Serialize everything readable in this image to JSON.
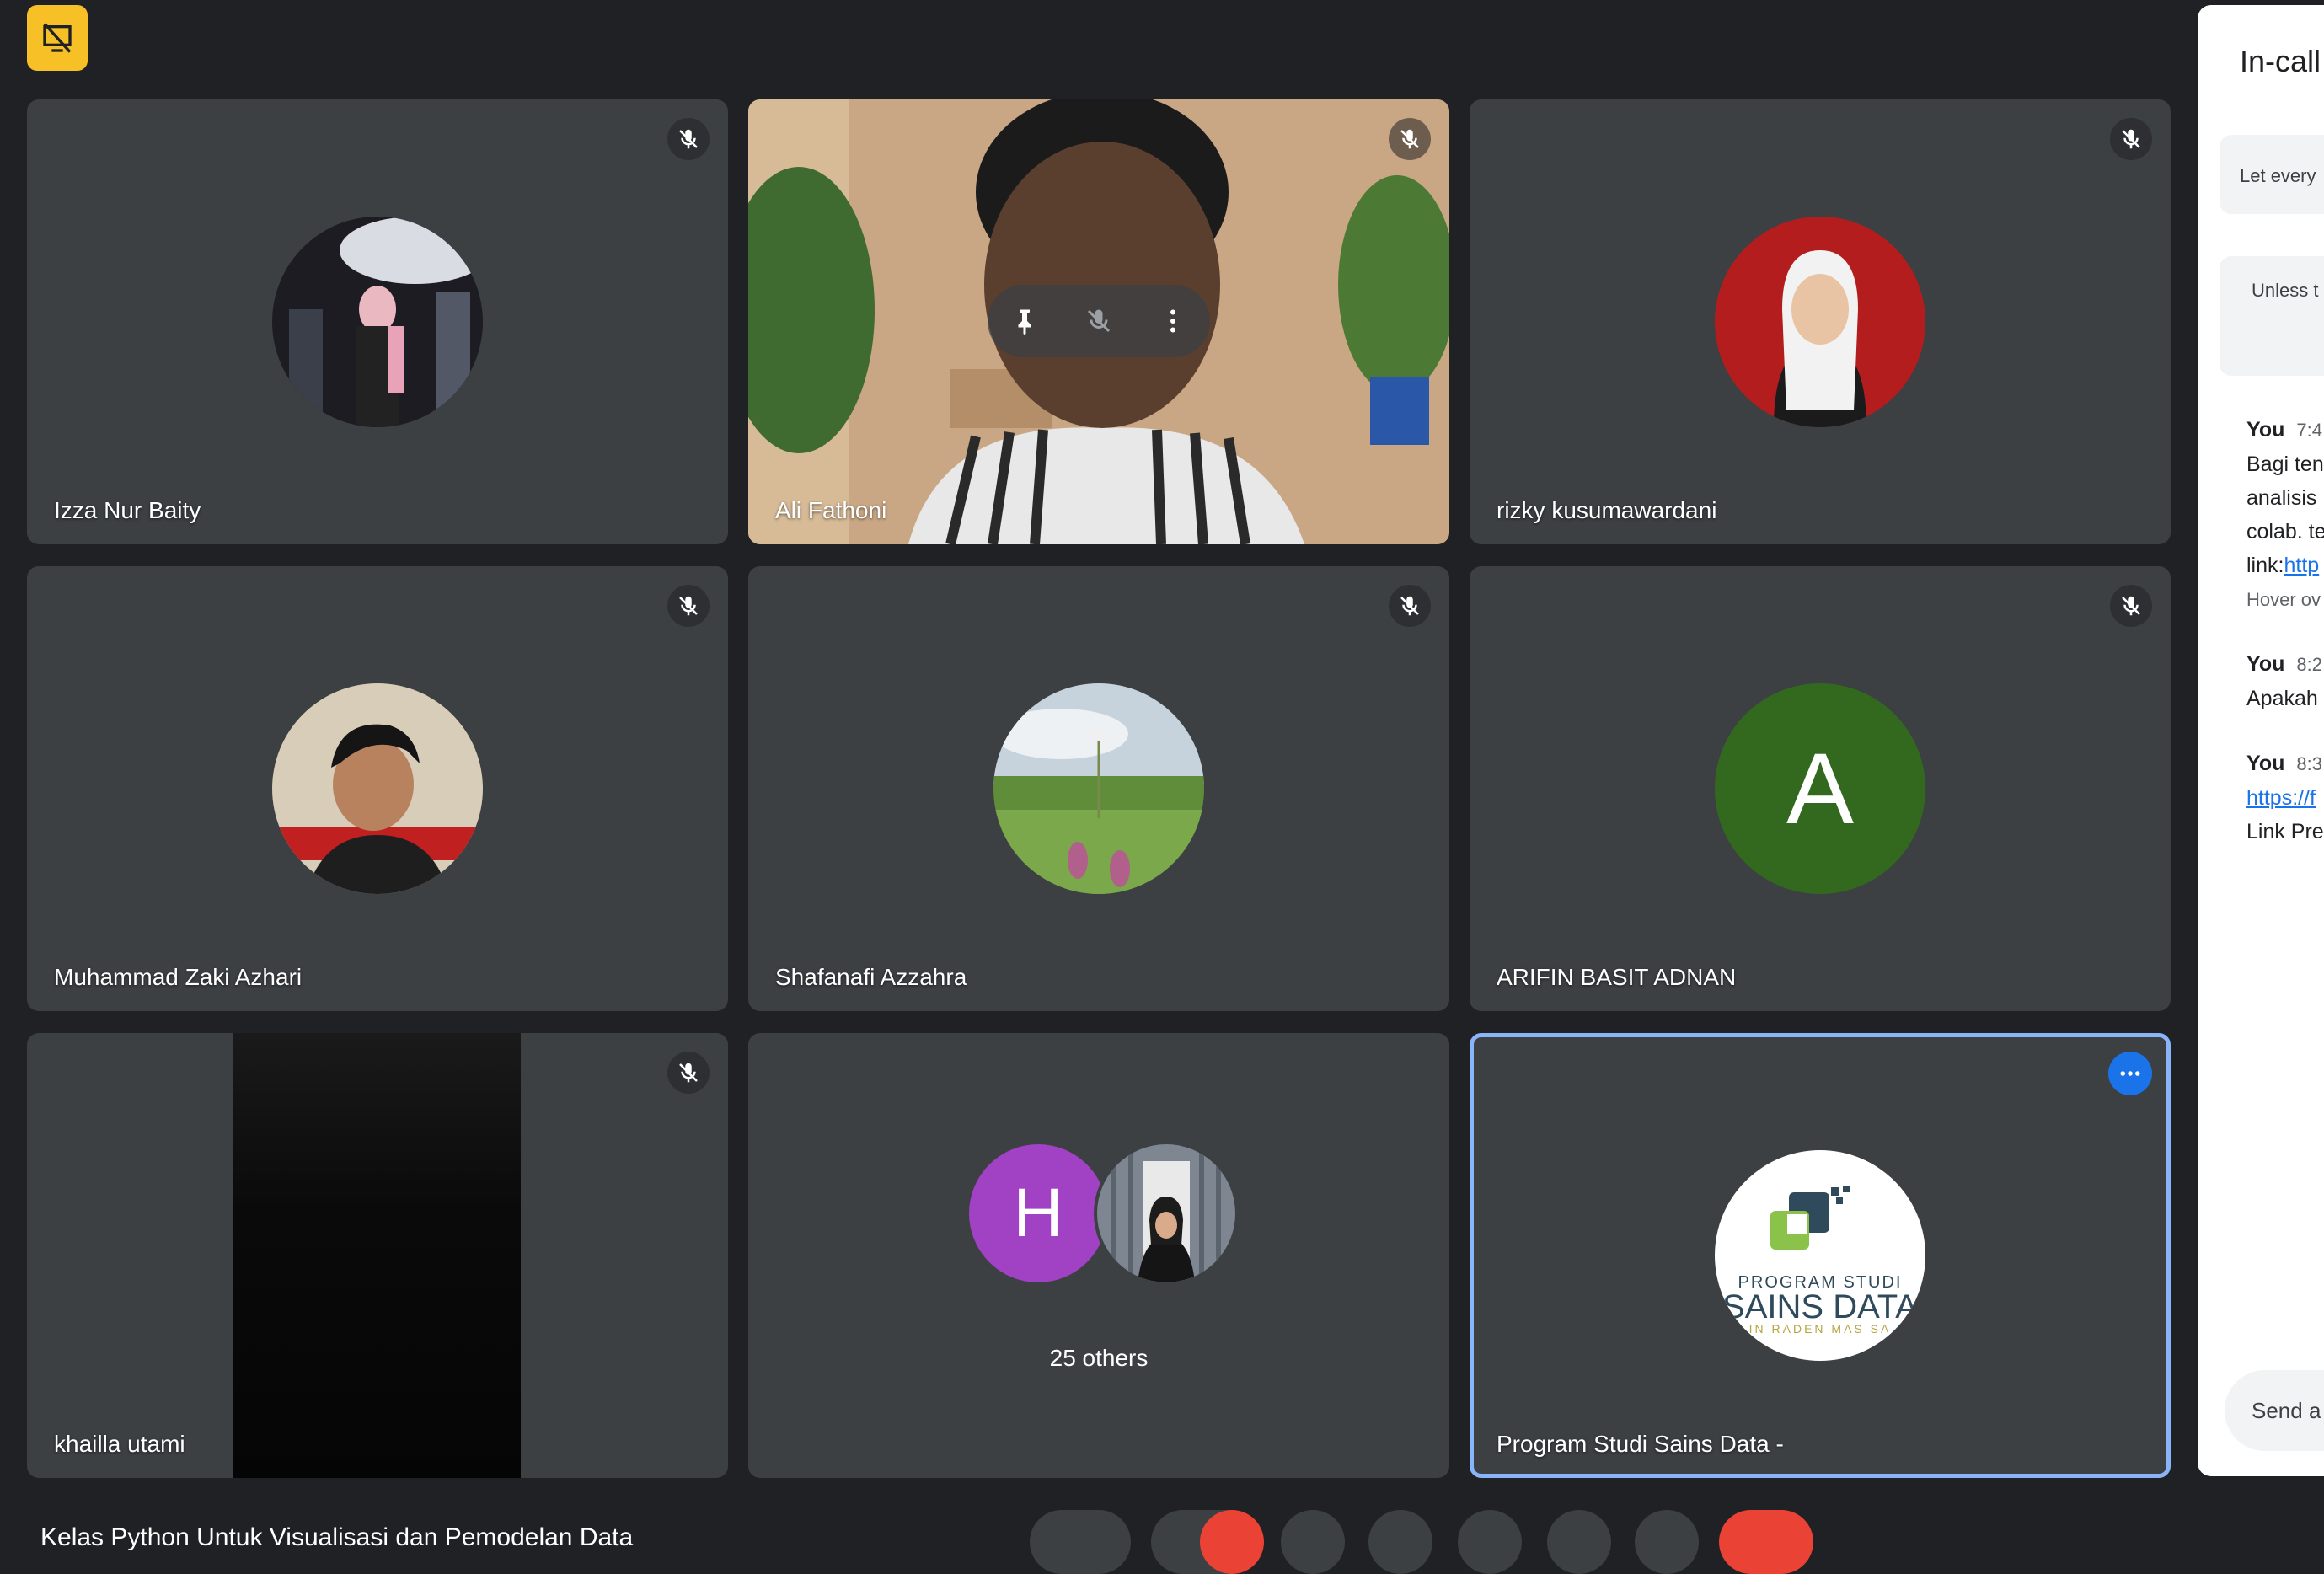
{
  "tiles": [
    {
      "name": "Izza Nur Baity"
    },
    {
      "name": "Ali Fathoni"
    },
    {
      "name": "rizky kusumawardani"
    },
    {
      "name": "Muhammad Zaki Azhari"
    },
    {
      "name": "Shafanafi Azzahra"
    },
    {
      "name": "ARIFIN BASIT ADNAN",
      "avatar_letter": "A",
      "avatar_color": "#33691e"
    },
    {
      "name": "khailla utami"
    },
    {
      "name": "25 others",
      "avatar_letter": "H",
      "avatar_color": "#a142c5"
    },
    {
      "name": "Program Studi Sains Data -",
      "logo_line1": "PROGRAM STUDI",
      "logo_line2": "SAINS DATA",
      "logo_line3": "IN RADEN MAS SA"
    }
  ],
  "side_panel": {
    "title": "In-call",
    "notice1": "Let every",
    "notice2": "Unless t peop m",
    "messages": [
      {
        "sender": "You",
        "time": "7:4",
        "lines": [
          "Bagi ten",
          "analisis",
          "colab. te"
        ],
        "link_prefix": "link:",
        "link": "http",
        "hint": "Hover ov"
      },
      {
        "sender": "You",
        "time": "8:2",
        "lines": [
          "Apakah"
        ]
      },
      {
        "sender": "You",
        "time": "8:3",
        "link": "https://f",
        "after": "Link Pre"
      }
    ],
    "send_placeholder": "Send a"
  },
  "meeting_title": "Kelas Python Untuk Visualisasi dan Pemodelan Data"
}
